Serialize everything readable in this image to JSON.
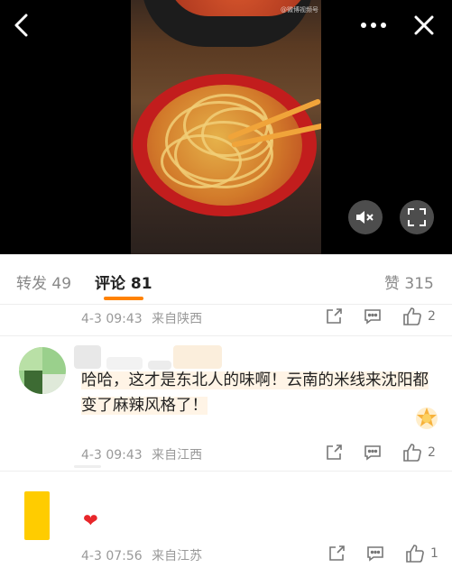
{
  "video": {
    "watermark": "@微博视频号"
  },
  "nav": {
    "back_icon": "chevron-left-icon",
    "more_icon": "more-horizontal-icon",
    "close_icon": "close-icon"
  },
  "controls": {
    "mute_icon": "volume-mute-icon",
    "fullscreen_icon": "fullscreen-icon"
  },
  "tabs": {
    "repost": "转发 49",
    "comments": "评论 81",
    "likes": "赞 315"
  },
  "comments": [
    {
      "time": "4-3 09:43",
      "location": "来自陕西",
      "like_count": "2"
    },
    {
      "text": "哈哈，这才是东北人的味啊！云南的米线来沈阳都变了麻辣风格了！",
      "time": "4-3 09:43",
      "location": "来自江西",
      "like_count": "2"
    },
    {
      "emoji": "❤",
      "time": "4-3 07:56",
      "location": "来自江苏",
      "like_count": "1"
    }
  ],
  "colors": {
    "accent": "#ff8200",
    "heart": "#e8262a"
  }
}
